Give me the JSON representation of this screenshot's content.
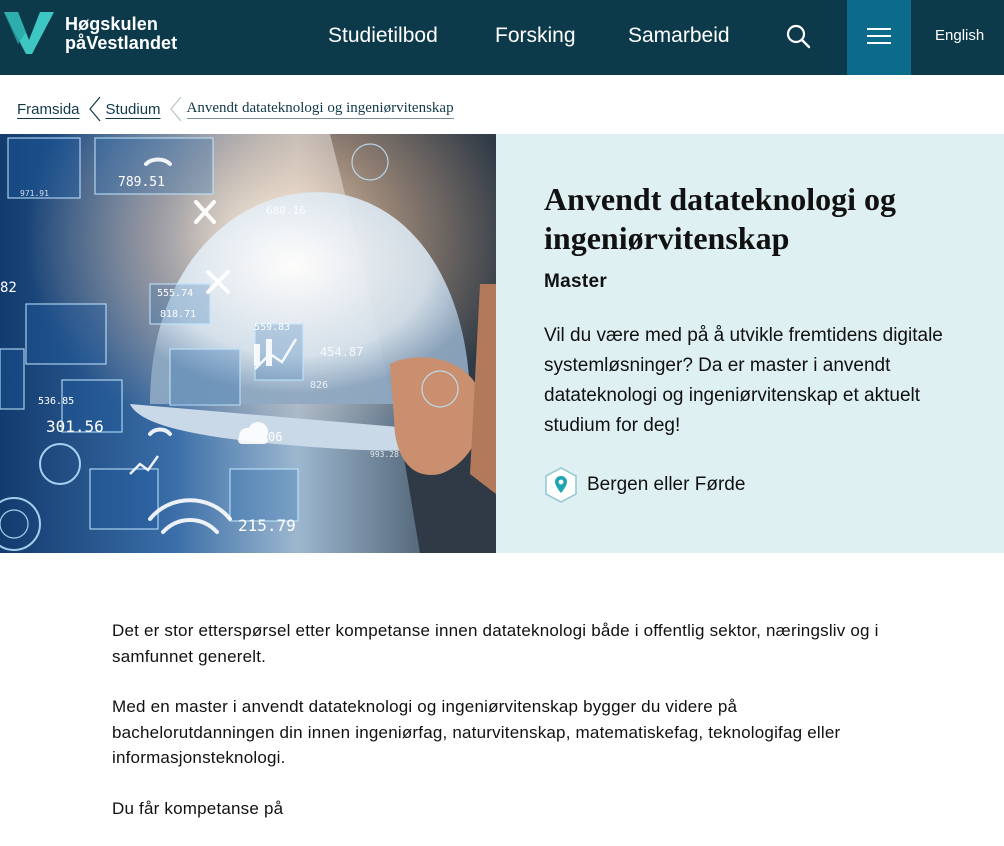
{
  "header": {
    "logo_line1": "Høgskulen",
    "logo_line2": "påVestlandet",
    "nav": [
      {
        "label": "Studietilbod"
      },
      {
        "label": "Forsking"
      },
      {
        "label": "Samarbeid"
      }
    ],
    "search_icon": "search-icon",
    "menu_icon": "hamburger-menu-icon",
    "language_label": "English"
  },
  "breadcrumb": {
    "items": [
      {
        "label": "Framsida"
      },
      {
        "label": "Studium"
      }
    ],
    "current": "Anvendt datateknologi og ingeniørvitenskap"
  },
  "hero": {
    "image_alt_icon": "hero-image",
    "title": "Anvendt datateknologi og ingeniørvitenskap",
    "subtitle": "Master",
    "lead": "Vil du være med på å utvikle fremtidens digitale systemløsninger? Da er master i anvendt datateknologi og ingeniørvitenskap et aktuelt studium for deg!",
    "location_icon": "location-pin-icon",
    "location": "Bergen eller Førde"
  },
  "hero_image_text": {
    "v1": "789.51",
    "v2": "680.16",
    "v3": "555.74",
    "v4": "818.71",
    "v5": "559.83",
    "v6": "454.87",
    "v7": "536.85",
    "v8": "301.56",
    "v9": "06",
    "v10": "826",
    "v11": "993.28",
    "v12": "215.79",
    "v13": "82",
    "v14": "971.91"
  },
  "content": {
    "paragraphs": [
      "Det er stor etterspørsel etter kompetanse innen datateknologi både i offentlig sektor, næringsliv og i samfunnet generelt.",
      "Med en master i anvendt datateknologi og ingeniørvitenskap bygger du videre på bachelorutdanningen din innen ingeniørfag, naturvitenskap, matematiskefag, teknologifag eller informasjonsteknologi.",
      "Du får kompetanse på"
    ]
  },
  "colors": {
    "header_bg": "#0d3a4a",
    "menu_bg": "#0c6a8a",
    "hero_panel_bg": "#dff0f3",
    "logo_accent": "#3ec6c3"
  }
}
